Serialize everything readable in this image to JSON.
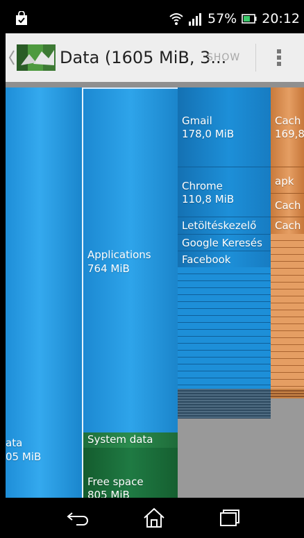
{
  "status_bar": {
    "notification_icon": "shopping-bag-check-icon",
    "wifi_icon": "wifi-icon",
    "signal_icon": "signal-icon",
    "battery_percent": "57%",
    "battery_icon": "battery-icon",
    "time": "20:12"
  },
  "action_bar": {
    "up_icon": "chevron-left-icon",
    "logo_icon": "disk-usage-logo-icon",
    "title": "Data (1605 MiB, 3...",
    "show_label": "SHOW",
    "overflow_icon": "more-vert-icon"
  },
  "treemap": {
    "data_root": {
      "name": "ata",
      "size": "05 MiB"
    },
    "applications": {
      "name": "Applications",
      "size": "764 MiB"
    },
    "system_data": {
      "name": "System data"
    },
    "free_space": {
      "name": "Free space",
      "size": "805 MiB"
    },
    "apps": [
      {
        "name": "Gmail",
        "size": "178,0 MiB"
      },
      {
        "name": "Chrome",
        "size": "110,8 MiB"
      },
      {
        "name": "Letöltéskezelő"
      },
      {
        "name": "Google Keresés"
      },
      {
        "name": "Facebook"
      }
    ],
    "app_details": [
      {
        "label": "Cach",
        "size": "169,8"
      },
      {
        "label": "apk"
      },
      {
        "label": "Cach"
      },
      {
        "label": "Cach"
      }
    ]
  },
  "nav_bar": {
    "back_icon": "back-arrow-icon",
    "home_icon": "home-icon",
    "recents_icon": "recent-apps-icon"
  },
  "colors": {
    "blue": "#2ea4ea",
    "dark_blue": "#1d8fd8",
    "orange": "#e59e63",
    "green": "#2b8c4f",
    "gray": "#999999"
  }
}
